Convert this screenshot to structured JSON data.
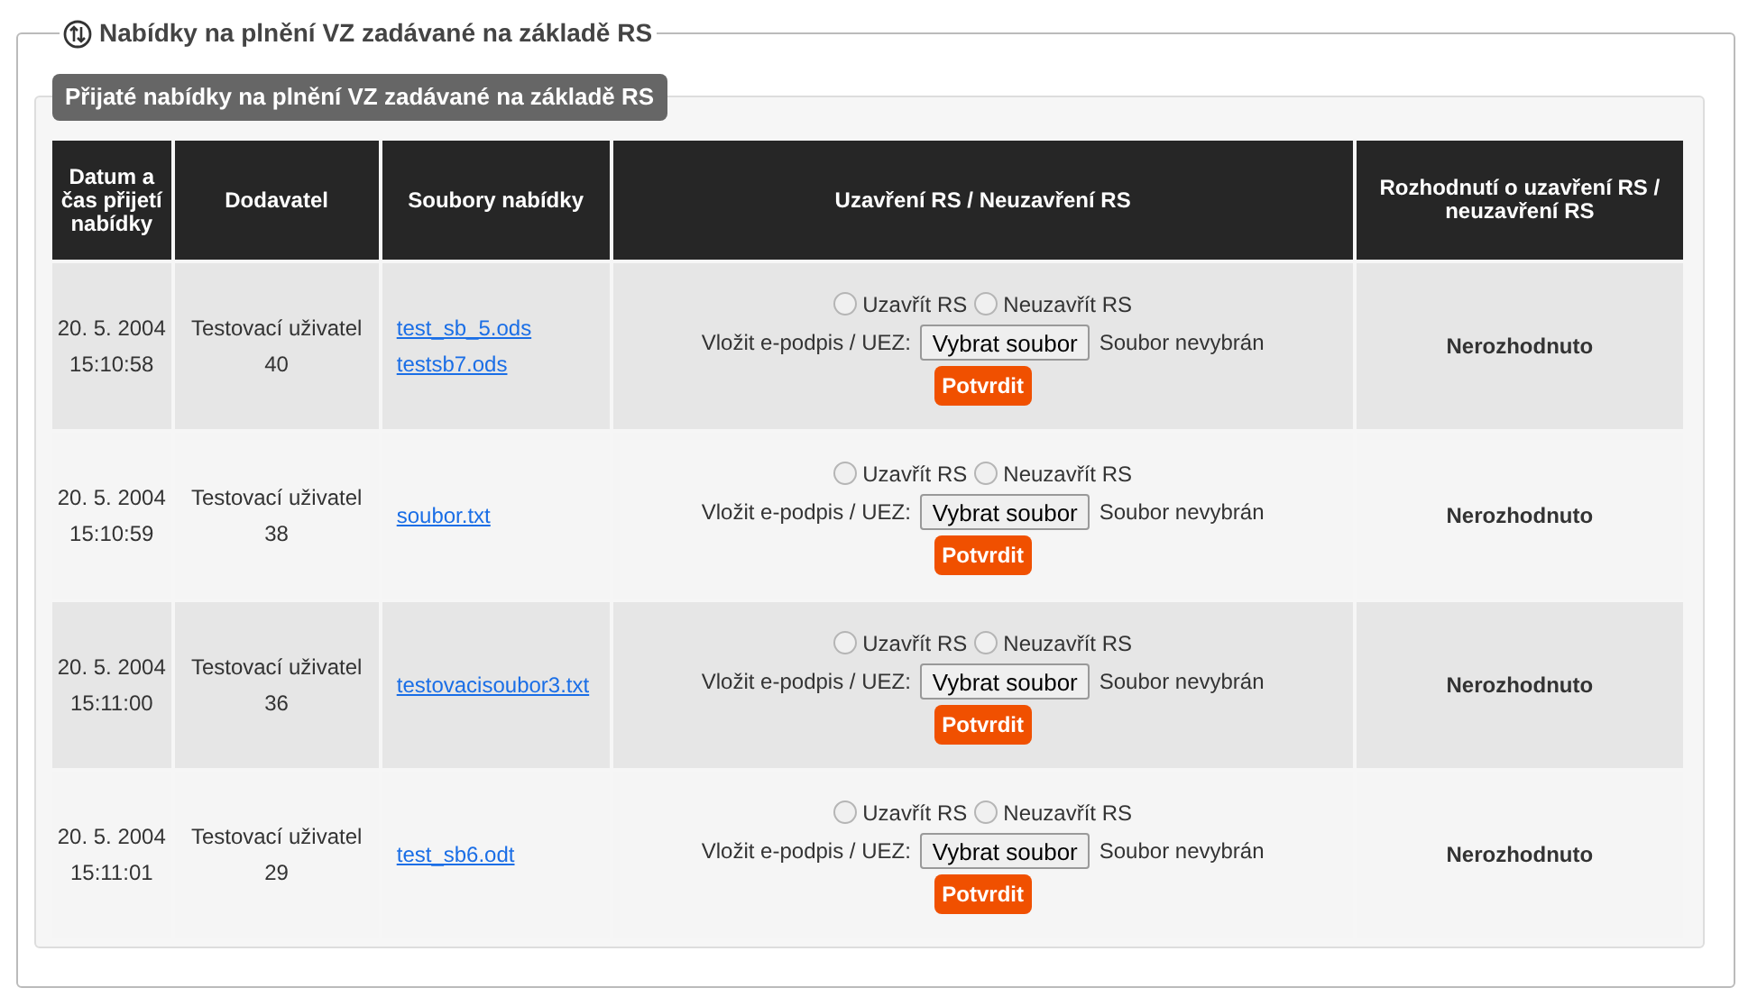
{
  "fieldset": {
    "legend": "Nabídky na plnění VZ zadávané na základě RS"
  },
  "panel": {
    "title": "Přijaté nabídky na plnění VZ zadávané na základě RS"
  },
  "table": {
    "columns": [
      "Datum a čas přijetí nabídky",
      "Dodavatel",
      "Soubory nabídky",
      "Uzavření RS / Neuzavření RS",
      "Rozhodnutí o uzavření RS / neuzavření RS"
    ],
    "rows": [
      {
        "date": "20. 5. 2004",
        "time": "15:10:58",
        "supplier": [
          "Testovací uživatel",
          "40"
        ],
        "files": [
          "test_sb_5.ods",
          "testsb7.ods"
        ],
        "options": [
          {
            "label": "Uzavřít RS",
            "selected": false
          },
          {
            "label": "Neuzavřít RS",
            "selected": false
          }
        ],
        "sign_label": "Vložit e-podpis / UEZ:",
        "file_button": "Vybrat soubor",
        "file_status": "Soubor nevybrán",
        "confirm": "Potvrdit",
        "decision": "Nerozhodnuto"
      },
      {
        "date": "20. 5. 2004",
        "time": "15:10:59",
        "supplier": [
          "Testovací uživatel",
          "38"
        ],
        "files": [
          "soubor.txt"
        ],
        "options": [
          {
            "label": "Uzavřít RS",
            "selected": false
          },
          {
            "label": "Neuzavřít RS",
            "selected": false
          }
        ],
        "sign_label": "Vložit e-podpis / UEZ:",
        "file_button": "Vybrat soubor",
        "file_status": "Soubor nevybrán",
        "confirm": "Potvrdit",
        "decision": "Nerozhodnuto"
      },
      {
        "date": "20. 5. 2004",
        "time": "15:11:00",
        "supplier": [
          "Testovací uživatel",
          "36"
        ],
        "files": [
          "testovacisoubor3.txt"
        ],
        "options": [
          {
            "label": "Uzavřít RS",
            "selected": false
          },
          {
            "label": "Neuzavřít RS",
            "selected": false
          }
        ],
        "sign_label": "Vložit e-podpis / UEZ:",
        "file_button": "Vybrat soubor",
        "file_status": "Soubor nevybrán",
        "confirm": "Potvrdit",
        "decision": "Nerozhodnuto"
      },
      {
        "date": "20. 5. 2004",
        "time": "15:11:01",
        "supplier": [
          "Testovací uživatel",
          "29"
        ],
        "files": [
          "test_sb6.odt"
        ],
        "options": [
          {
            "label": "Uzavřít RS",
            "selected": false
          },
          {
            "label": "Neuzavřít RS",
            "selected": false
          }
        ],
        "sign_label": "Vložit e-podpis / UEZ:",
        "file_button": "Vybrat soubor",
        "file_status": "Soubor nevybrán",
        "confirm": "Potvrdit",
        "decision": "Nerozhodnuto"
      }
    ]
  }
}
